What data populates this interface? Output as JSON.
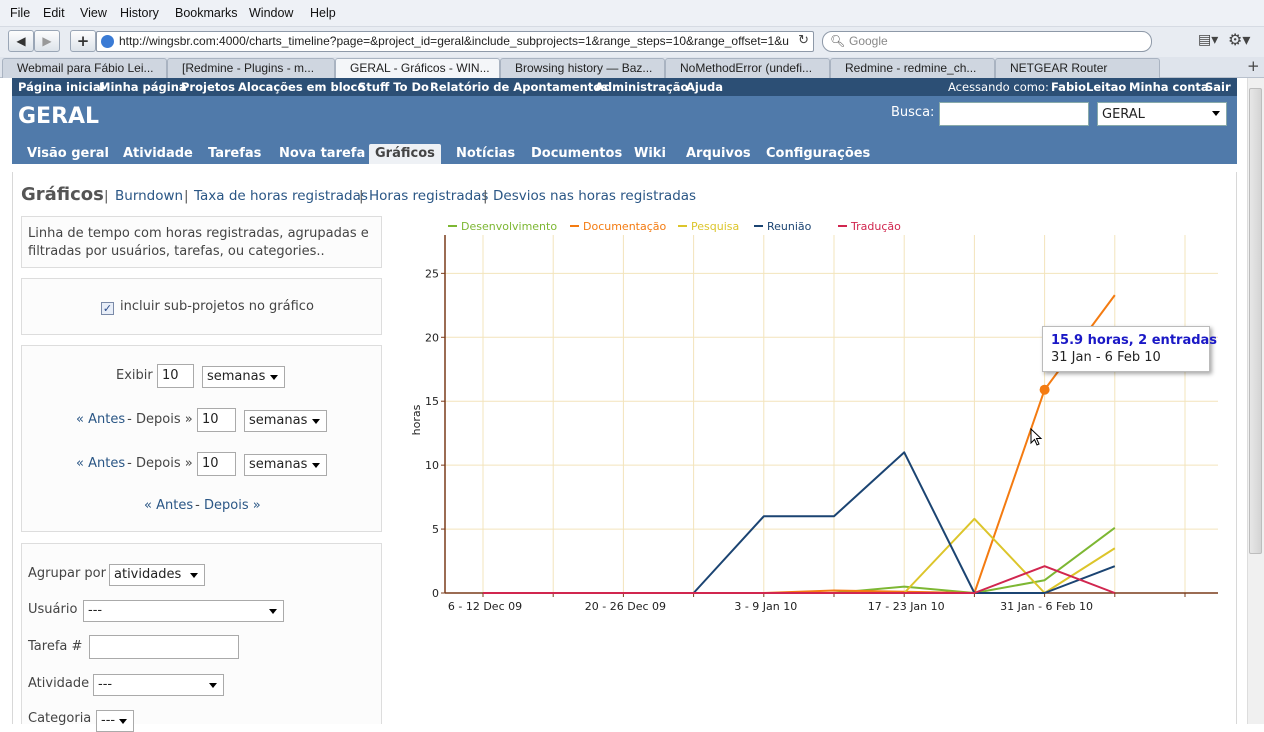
{
  "browser": {
    "menu": [
      "File",
      "Edit",
      "View",
      "History",
      "Bookmarks",
      "Window",
      "Help"
    ],
    "url": "http://wingsbr.com:4000/charts_timeline?page=&project_id=geral&include_subprojects=1&range_steps=10&range_offset=1&u",
    "search_placeholder": "Google",
    "tabs": [
      "Webmail para Fábio Lei...",
      "[Redmine - Plugins - m...",
      "GERAL - Gráficos - WIN...",
      "Browsing history — Baz...",
      "NoMethodError (undefi...",
      "Redmine - redmine_ch...",
      "NETGEAR Router"
    ],
    "new_tab": "+"
  },
  "top_menu": {
    "left": [
      "Página inicial",
      "Minha página",
      "Projetos",
      "Alocações em bloco",
      "Stuff To Do",
      "Relatório de Apontamentos",
      "Administração",
      "Ajuda"
    ],
    "logged_as_prefix": "Acessando como:",
    "user": "FabioLeitao",
    "account": "Minha conta",
    "logout": "Sair"
  },
  "header": {
    "project": "GERAL",
    "search_label": "Busca:",
    "project_select": "GERAL"
  },
  "main_tabs": [
    "Visão geral",
    "Atividade",
    "Tarefas",
    "Nova tarefa",
    "Gráficos",
    "Notícias",
    "Documentos",
    "Wiki",
    "Arquivos",
    "Configurações"
  ],
  "page": {
    "title": "Gráficos",
    "links": [
      "Burndown",
      "Taxa de horas registradas",
      "Horas registradas",
      "Desvios nas horas registradas"
    ]
  },
  "sidebar": {
    "description": "Linha de tempo com horas registradas, agrupadas e filtradas por usuários, tarefas, ou categories..",
    "include_subprojects": "incluir sub-projetos no gráfico",
    "show_label": "Exibir",
    "show_value": "10",
    "unit": "semanas",
    "before": "« Antes",
    "dash": " - ",
    "after": "Depois »",
    "offset1": "10",
    "offset2": "10",
    "group_label": "Agrupar por",
    "group_value": "atividades",
    "user_label": "Usuário",
    "user_value": "---",
    "task_label": "Tarefa #",
    "activity_label": "Atividade",
    "activity_value": "---",
    "category_label": "Categoria",
    "category_value": "---"
  },
  "tooltip": {
    "line1": "15.9 horas, 2 entradas",
    "line2": "31 Jan - 6 Feb 10"
  },
  "chart_data": {
    "type": "line",
    "ylabel": "horas",
    "ylim": [
      0,
      28
    ],
    "yticks": [
      0,
      5,
      10,
      15,
      20,
      25
    ],
    "xtick_labels": [
      "6 - 12 Dec 09",
      "20 - 26 Dec 09",
      "3 - 9 Jan 10",
      "17 - 23 Jan 10",
      "31 Jan - 6 Feb 10"
    ],
    "x_index_of_labels": [
      0,
      2,
      4,
      6,
      8
    ],
    "legend_position": "top",
    "series": [
      {
        "name": "Desenvolvimento",
        "color": "#7db733",
        "values": [
          0,
          0,
          0,
          0,
          0,
          0,
          0.5,
          0,
          1,
          5.1
        ]
      },
      {
        "name": "Documentação",
        "color": "#f47b11",
        "values": [
          0,
          0,
          0,
          0,
          0,
          0.2,
          0.1,
          0,
          15.9,
          23.3
        ]
      },
      {
        "name": "Pesquisa",
        "color": "#dcc52b",
        "values": [
          0,
          0,
          0,
          0,
          0,
          0,
          0,
          5.8,
          0,
          3.5
        ]
      },
      {
        "name": "Reunião",
        "color": "#1b4472",
        "values": [
          0,
          0,
          0,
          0,
          6,
          6,
          11,
          0,
          0,
          2.1
        ]
      },
      {
        "name": "Tradução",
        "color": "#d1264f",
        "values": [
          0,
          0,
          0,
          0,
          0,
          0,
          0,
          0,
          2.1,
          0
        ]
      }
    ],
    "highlight": {
      "series": "Documentação",
      "index": 8
    }
  }
}
